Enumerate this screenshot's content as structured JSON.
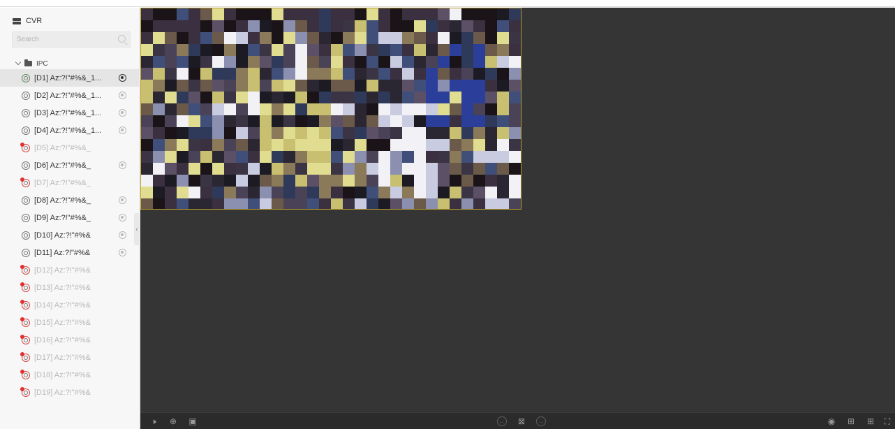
{
  "sidebar": {
    "root_label": "CVR",
    "search_placeholder": "Search",
    "group_label": "IPC",
    "devices": [
      {
        "label": "[D1] Az:?!\"#%&_1...",
        "status": "live",
        "selected": true,
        "recording": true
      },
      {
        "label": "[D2] Az:?!\"#%&_1...",
        "status": "online"
      },
      {
        "label": "[D3] Az:?!\"#%&_1...",
        "status": "online"
      },
      {
        "label": "[D4] Az:?!\"#%&_1...",
        "status": "online"
      },
      {
        "label": "[D5] Az:?!\"#%&_",
        "status": "offline"
      },
      {
        "label": "[D6] Az:?!\"#%&_",
        "status": "online"
      },
      {
        "label": "[D7] Az:?!\"#%&_",
        "status": "offline"
      },
      {
        "label": "[D8] Az:?!\"#%&_",
        "status": "online"
      },
      {
        "label": "[D9] Az:?!\"#%&_",
        "status": "online"
      },
      {
        "label": "[D10] Az:?!\"#%&",
        "status": "online"
      },
      {
        "label": "[D11] Az:?!\"#%&",
        "status": "online"
      },
      {
        "label": "[D12] Az:?!\"#%&",
        "status": "offline"
      },
      {
        "label": "[D13] Az:?!\"#%&",
        "status": "offline"
      },
      {
        "label": "[D14] Az:?!\"#%&",
        "status": "offline"
      },
      {
        "label": "[D15] Az:?!\"#%&",
        "status": "offline"
      },
      {
        "label": "[D16] Az:?!\"#%&",
        "status": "offline"
      },
      {
        "label": "[D17] Az:?!\"#%&",
        "status": "offline"
      },
      {
        "label": "[D18] Az:?!\"#%&",
        "status": "offline"
      },
      {
        "label": "[D19] Az:?!\"#%&",
        "status": "offline"
      }
    ]
  },
  "colors": {
    "selected_border": "#b89a2c",
    "offline_badge": "#e03030",
    "video_bg": "#353535"
  },
  "toolbar": {
    "left_icons": [
      "mute-icon",
      "zoom-in-icon",
      "snapshot-icon"
    ],
    "center_icons": [
      "prev-page-icon",
      "close-all-icon",
      "next-page-icon"
    ],
    "right_icons": [
      "record-icon",
      "window-fit-icon",
      "grid-layout-icon",
      "fullscreen-icon"
    ]
  }
}
